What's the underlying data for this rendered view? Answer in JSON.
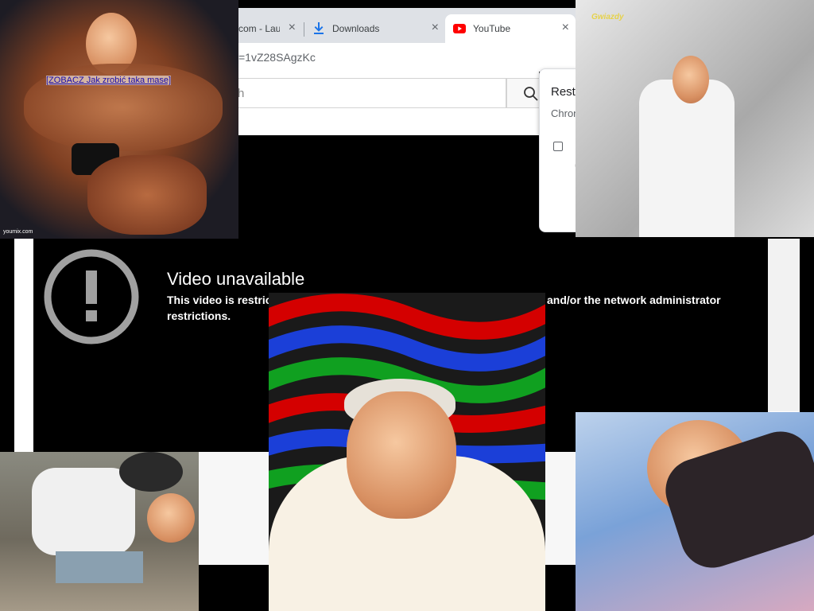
{
  "browser": {
    "tabs": [
      {
        "label": "com - Lau",
        "close": "×"
      },
      {
        "label": "Downloads",
        "close": "×",
        "icon": "download-icon"
      },
      {
        "label": "YouTube",
        "close": "×",
        "icon": "youtube-icon",
        "active": true
      }
    ],
    "address_url": "=1vZ28SAgzKc"
  },
  "youtube": {
    "search_placeholder": "h",
    "search_icon": "search-icon"
  },
  "restore_popup": {
    "title": "Resto",
    "subtitle": "Chron"
  },
  "player": {
    "error_title": "Video unavailable",
    "error_body_start": "This video is restrict",
    "error_body_end": "and/or the network administrator",
    "error_body_line2": "restrictions.",
    "icon": "warning-icon"
  },
  "overlays": {
    "ad_link": "[ZOBACZ Jak zrobić taka mase]",
    "watermark": "youmix.com",
    "tv_logo": "Gwiazdy"
  },
  "colors": {
    "youtube_red": "#ff0000",
    "link_blue": "#1a0dab",
    "player_bg": "#000000"
  }
}
